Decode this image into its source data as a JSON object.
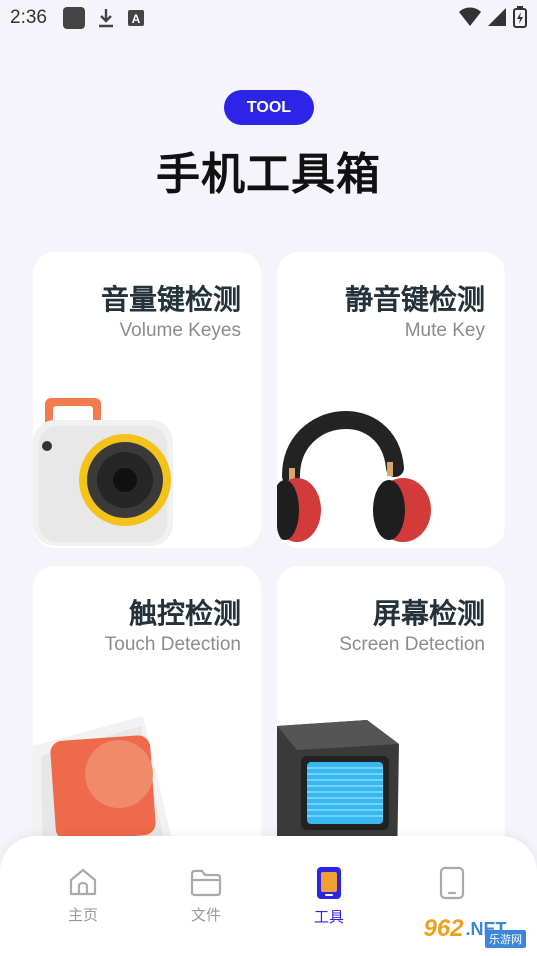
{
  "status_bar": {
    "time": "2:36",
    "icons": [
      "app-square-icon",
      "download-icon",
      "a-badge-icon",
      "wifi-icon",
      "signal-icon",
      "battery-charging-icon"
    ]
  },
  "header": {
    "badge": "TOOL",
    "title": "手机工具箱"
  },
  "cards": [
    {
      "title": "音量键检测",
      "subtitle": "Volume Keyes",
      "art": "speaker-box-icon"
    },
    {
      "title": "静音键检测",
      "subtitle": "Mute Key",
      "art": "headphones-icon"
    },
    {
      "title": "触控检测",
      "subtitle": "Touch Detection",
      "art": "touch-button-icon"
    },
    {
      "title": "屏幕检测",
      "subtitle": "Screen Detection",
      "art": "monitor-icon"
    }
  ],
  "bottom_nav": {
    "items": [
      {
        "label": "主页",
        "icon": "home-icon",
        "active": false
      },
      {
        "label": "文件",
        "icon": "folder-icon",
        "active": false
      },
      {
        "label": "工具",
        "icon": "phone-tool-icon",
        "active": true
      },
      {
        "label": "",
        "icon": "phone-icon",
        "active": false
      }
    ]
  },
  "watermark": {
    "number": "962",
    "domain": ".NET",
    "caption": "乐游网"
  },
  "colors": {
    "accent": "#2c25e8",
    "background": "#f4f4fa",
    "card": "#ffffff"
  }
}
